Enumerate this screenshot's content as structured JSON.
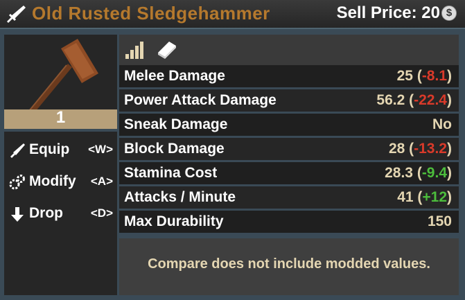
{
  "header": {
    "title": "Old Rusted Sledgehammer",
    "sell_label": "Sell Price: 20",
    "coin_glyph": "$"
  },
  "item": {
    "quantity": "1"
  },
  "actions": [
    {
      "label": "Equip",
      "key": "<W>",
      "icon": "sword-icon"
    },
    {
      "label": "Modify",
      "key": "<A>",
      "icon": "gears-icon"
    },
    {
      "label": "Drop",
      "key": "<D>",
      "icon": "down-arrow-icon"
    }
  ],
  "stats": [
    {
      "name": "Melee Damage",
      "value": "25",
      "diff": "-8.1",
      "diff_type": "neg"
    },
    {
      "name": "Power Attack Damage",
      "value": "56.2",
      "diff": "-22.4",
      "diff_type": "neg"
    },
    {
      "name": "Sneak Damage",
      "value": "No",
      "diff": "",
      "diff_type": ""
    },
    {
      "name": "Block Damage",
      "value": "28",
      "diff": "-13.2",
      "diff_type": "neg"
    },
    {
      "name": "Stamina Cost",
      "value": "28.3",
      "diff": "-9.4",
      "diff_type": "pos"
    },
    {
      "name": "Attacks / Minute",
      "value": "41",
      "diff": "+12",
      "diff_type": "pos"
    },
    {
      "name": "Max Durability",
      "value": "150",
      "diff": "",
      "diff_type": ""
    }
  ],
  "note": "Compare does not include modded values.",
  "colors": {
    "title": "#b5792d",
    "value": "#e4d6b2",
    "negative": "#d93a2a",
    "positive": "#4cbd3c"
  }
}
